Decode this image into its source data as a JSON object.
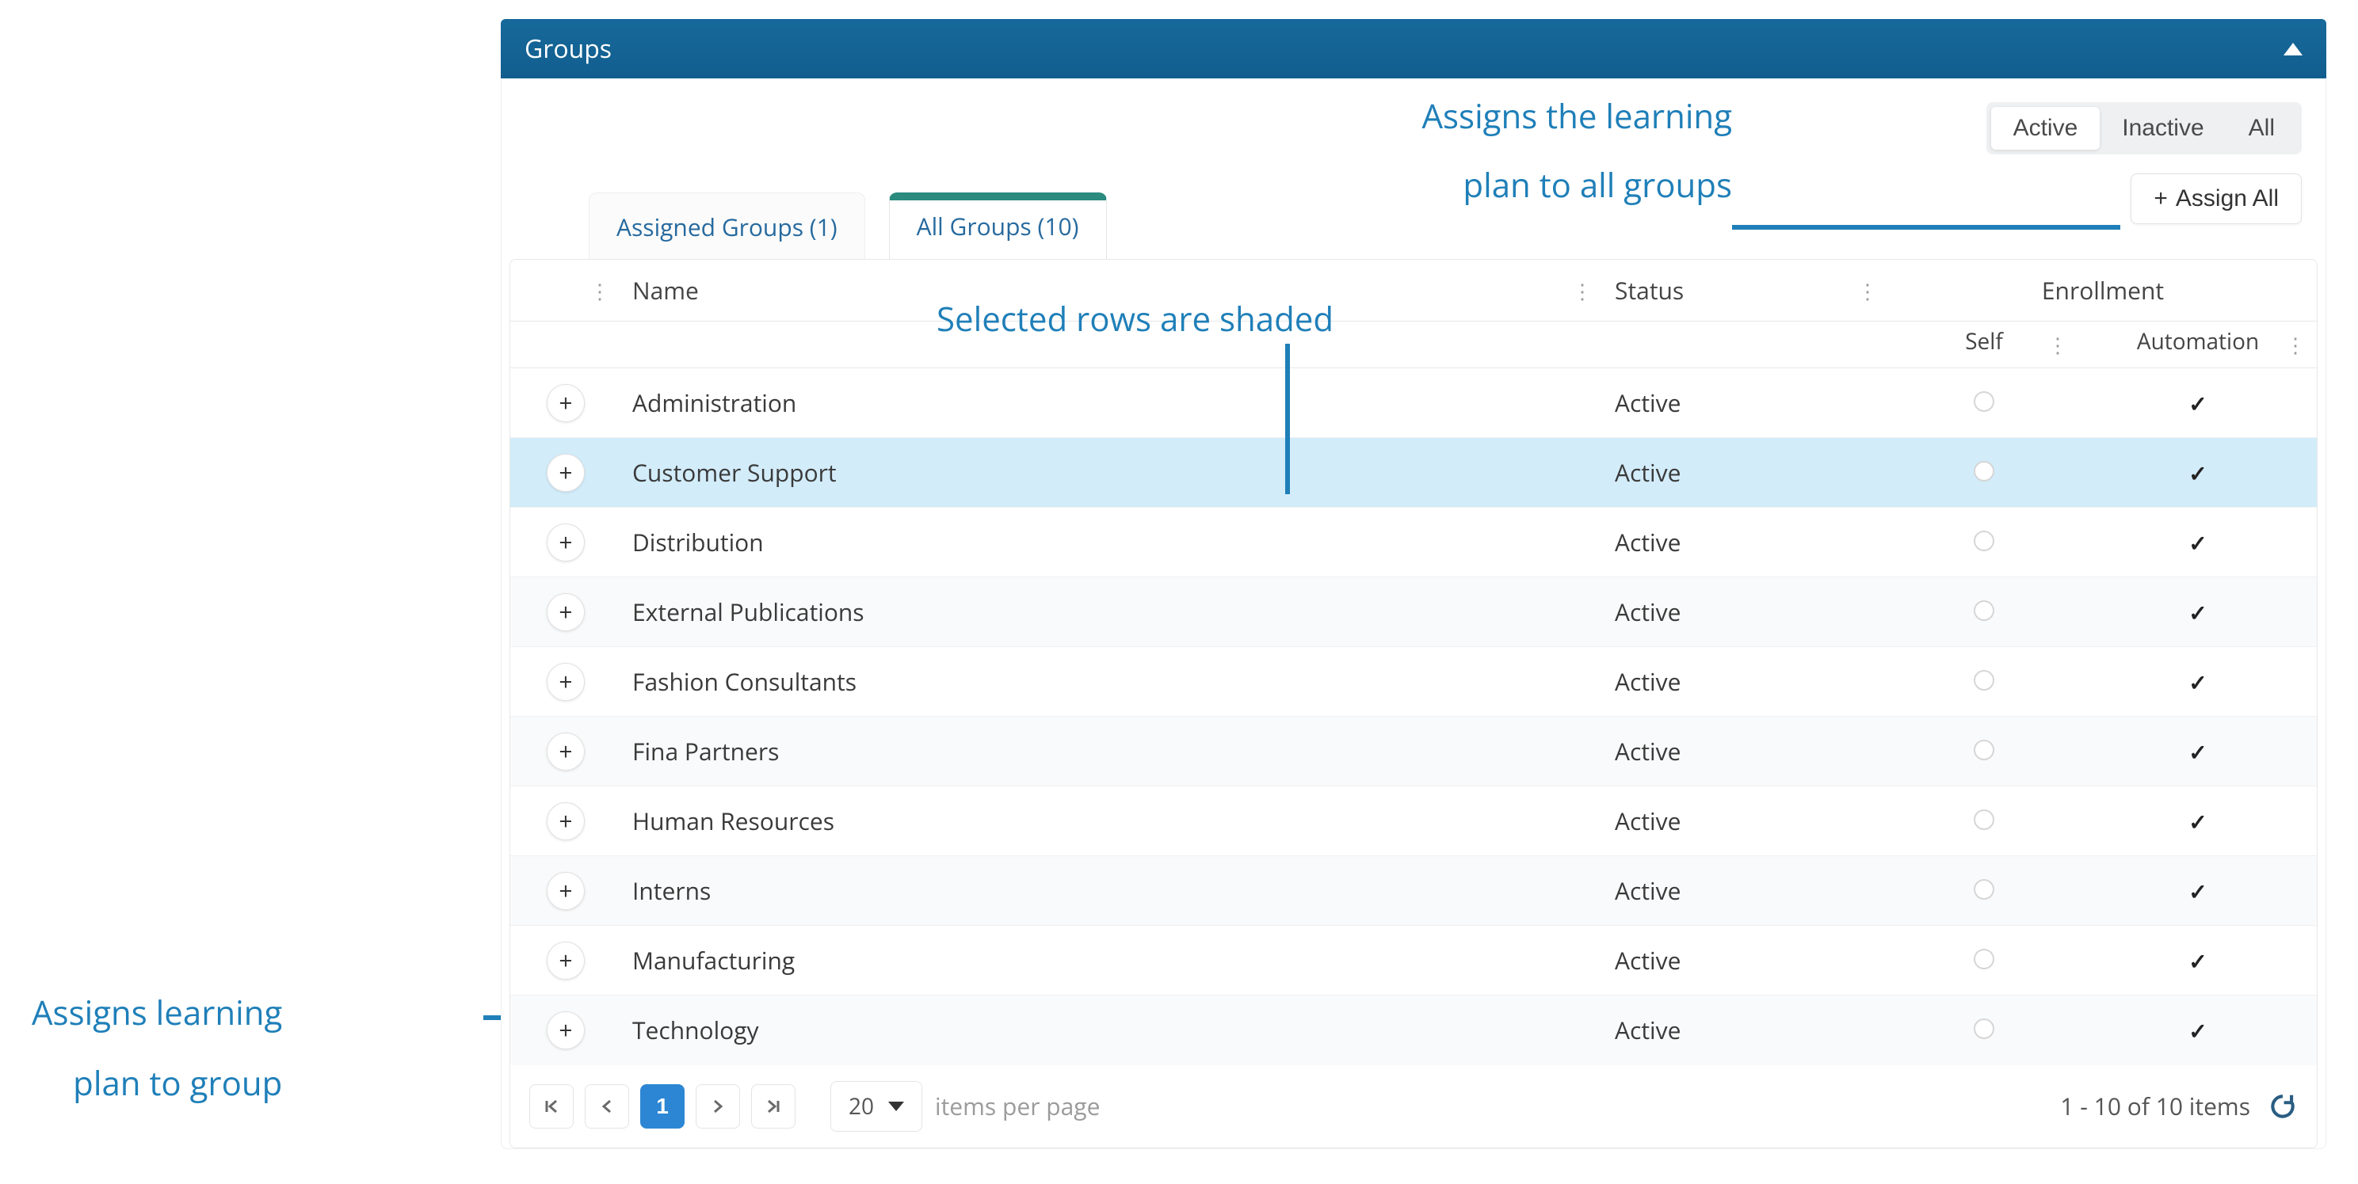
{
  "panel": {
    "title": "Groups"
  },
  "filters": {
    "options": [
      "Active",
      "Inactive",
      "All"
    ],
    "active_index": 0
  },
  "assign_all": {
    "label": "Assign All"
  },
  "tabs": [
    {
      "label": "Assigned Groups (1)",
      "active": false
    },
    {
      "label": "All Groups (10)",
      "active": true
    }
  ],
  "columns": {
    "name": "Name",
    "status": "Status",
    "enrollment": "Enrollment",
    "self": "Self",
    "automation": "Automation"
  },
  "rows": [
    {
      "name": "Administration",
      "status": "Active",
      "self": false,
      "automation": true,
      "selected": false
    },
    {
      "name": "Customer Support",
      "status": "Active",
      "self": false,
      "automation": true,
      "selected": true
    },
    {
      "name": "Distribution",
      "status": "Active",
      "self": false,
      "automation": true,
      "selected": false
    },
    {
      "name": "External Publications",
      "status": "Active",
      "self": false,
      "automation": true,
      "selected": false
    },
    {
      "name": "Fashion Consultants",
      "status": "Active",
      "self": false,
      "automation": true,
      "selected": false
    },
    {
      "name": "Fina Partners",
      "status": "Active",
      "self": false,
      "automation": true,
      "selected": false
    },
    {
      "name": "Human Resources",
      "status": "Active",
      "self": false,
      "automation": true,
      "selected": false
    },
    {
      "name": "Interns",
      "status": "Active",
      "self": false,
      "automation": true,
      "selected": false
    },
    {
      "name": "Manufacturing",
      "status": "Active",
      "self": false,
      "automation": true,
      "selected": false
    },
    {
      "name": "Technology",
      "status": "Active",
      "self": false,
      "automation": true,
      "selected": false
    }
  ],
  "pager": {
    "current_page": "1",
    "page_size": "20",
    "items_label": "items per page",
    "range_label": "1 - 10 of 10 items"
  },
  "annotations": {
    "assign_all": "Assigns the learning plan to all groups",
    "selected_rows": "Selected rows are shaded",
    "assign_row": "Assigns learning plan to group"
  }
}
